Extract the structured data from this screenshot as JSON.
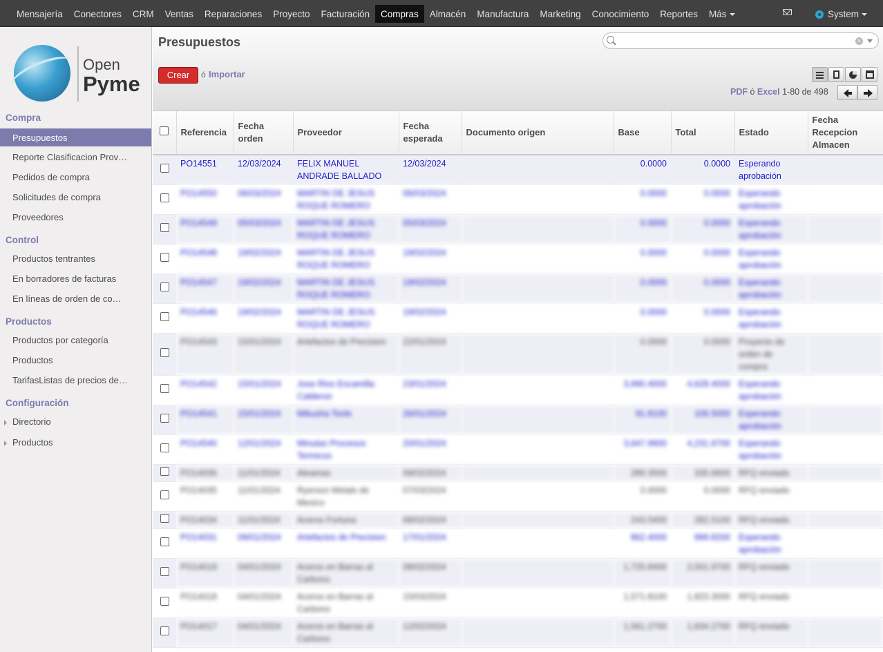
{
  "topbar": {
    "menu": [
      "Mensajería",
      "Conectores",
      "CRM",
      "Ventas",
      "Reparaciones",
      "Proyecto",
      "Facturación",
      "Compras",
      "Almacén",
      "Manufactura",
      "Marketing",
      "Conocimiento",
      "Reportes",
      "Más"
    ],
    "user": "System"
  },
  "logo": {
    "open": "Open",
    "pyme": "Pyme"
  },
  "sidebar": {
    "sections": [
      {
        "title": "Compra",
        "items": [
          "Presupuestos",
          "Reporte Clasificacion Prov…",
          "Pedidos de compra",
          "Solicitudes de compra",
          "Proveedores"
        ]
      },
      {
        "title": "Control",
        "items": [
          "Productos tentrantes",
          "En borradores de facturas",
          "En líneas de orden de co…"
        ]
      },
      {
        "title": "Productos",
        "items": [
          "Productos por categoría",
          "Productos",
          "TarifasListas de precios de…"
        ]
      },
      {
        "title": "Configuración",
        "items": [
          "Directorio",
          "Productos"
        ]
      }
    ]
  },
  "header": {
    "title": "Presupuestos",
    "create": "Crear",
    "or": "ó",
    "import": "Importar",
    "pdf": "PDF",
    "excel": "Excel",
    "pager": "1-80 de 498"
  },
  "table": {
    "columns": [
      "Referencia",
      "Fecha orden",
      "Proveedor",
      "Fecha esperada",
      "Documento origen",
      "Base",
      "Total",
      "Estado",
      "Fecha Recepcion Almacen"
    ],
    "rows": [
      {
        "ref": "PO14551",
        "fecha": "12/03/2024",
        "prov": "FELIX MANUEL ANDRADE BALLADO",
        "esperada": "12/03/2024",
        "doc": "",
        "base": "0.0000",
        "total": "0.0000",
        "estado": "Esperando aprobación",
        "recep": "",
        "blue": true,
        "blur": false
      },
      {
        "ref": "PO14550",
        "fecha": "06/03/2024",
        "prov": "MARTIN DE JESUS ROQUE ROMERO",
        "esperada": "06/03/2024",
        "doc": "",
        "base": "0.0000",
        "total": "0.0000",
        "estado": "Esperando aprobación",
        "recep": "",
        "blue": true,
        "blur": true
      },
      {
        "ref": "PO14549",
        "fecha": "05/03/2024",
        "prov": "MARTIN DE JESUS ROQUE ROMERO",
        "esperada": "05/03/2024",
        "doc": "",
        "base": "0.0000",
        "total": "0.0000",
        "estado": "Esperando aprobación",
        "recep": "",
        "blue": true,
        "blur": true
      },
      {
        "ref": "PO14548",
        "fecha": "19/02/2024",
        "prov": "MARTIN DE JESUS ROQUE ROMERO",
        "esperada": "19/02/2024",
        "doc": "",
        "base": "0.0000",
        "total": "0.0000",
        "estado": "Esperando aprobación",
        "recep": "",
        "blue": true,
        "blur": true
      },
      {
        "ref": "PO14547",
        "fecha": "19/02/2024",
        "prov": "MARTIN DE JESUS ROQUE ROMERO",
        "esperada": "19/02/2024",
        "doc": "",
        "base": "0.0000",
        "total": "0.0000",
        "estado": "Esperando aprobación",
        "recep": "",
        "blue": true,
        "blur": true
      },
      {
        "ref": "PO14546",
        "fecha": "19/02/2024",
        "prov": "MARTIN DE JESUS ROQUE ROMERO",
        "esperada": "19/02/2024",
        "doc": "",
        "base": "0.0000",
        "total": "0.0000",
        "estado": "Esperando aprobación",
        "recep": "",
        "blue": true,
        "blur": true
      },
      {
        "ref": "PO14543",
        "fecha": "15/01/2024",
        "prov": "Artefactos de Precision",
        "esperada": "22/01/2024",
        "doc": "",
        "base": "0.0000",
        "total": "0.0000",
        "estado": "Proyecto de orden de compra",
        "recep": "",
        "blue": false,
        "blur": true
      },
      {
        "ref": "PO14542",
        "fecha": "15/01/2024",
        "prov": "Jose Rios Escamilla Calderon",
        "esperada": "23/01/2024",
        "doc": "",
        "base": "3,990.4000",
        "total": "4,628.4000",
        "estado": "Esperando aprobación",
        "recep": "",
        "blue": true,
        "blur": true
      },
      {
        "ref": "PO14541",
        "fecha": "15/01/2024",
        "prov": "Mikusha Tools",
        "esperada": "26/01/2024",
        "doc": "",
        "base": "91.8100",
        "total": "106.5000",
        "estado": "Esperando aprobación",
        "recep": "",
        "blue": true,
        "blur": true
      },
      {
        "ref": "PO14540",
        "fecha": "12/01/2024",
        "prov": "Minutas Procesos Termicos",
        "esperada": "20/01/2024",
        "doc": "",
        "base": "3,647.9900",
        "total": "4,231.6700",
        "estado": "Esperando aprobación",
        "recep": "",
        "blue": true,
        "blur": true
      },
      {
        "ref": "PO14036",
        "fecha": "11/01/2024",
        "prov": "Aleamas",
        "esperada": "09/02/2024",
        "doc": "",
        "base": "289.3500",
        "total": "335.6600",
        "estado": "RFQ enviado",
        "recep": "",
        "blue": false,
        "blur": true
      },
      {
        "ref": "PO14035",
        "fecha": "11/01/2024",
        "prov": "Ryerson Metals de Mexico",
        "esperada": "07/03/2024",
        "doc": "",
        "base": "0.0000",
        "total": "0.0000",
        "estado": "RFQ enviado",
        "recep": "",
        "blue": false,
        "blur": true
      },
      {
        "ref": "PO14034",
        "fecha": "11/01/2024",
        "prov": "Aceros Fortuna",
        "esperada": "08/02/2024",
        "doc": "",
        "base": "243.5400",
        "total": "282.5100",
        "estado": "RFQ enviado",
        "recep": "",
        "blue": false,
        "blur": true
      },
      {
        "ref": "PO14031",
        "fecha": "09/01/2024",
        "prov": "Artefactos de Precision",
        "esperada": "17/01/2024",
        "doc": "",
        "base": "862.4000",
        "total": "999.8200",
        "estado": "Esperando aprobación",
        "recep": "",
        "blue": true,
        "blur": true
      },
      {
        "ref": "PO14019",
        "fecha": "04/01/2024",
        "prov": "Aceros en Barras al Carbono",
        "esperada": "08/02/2024",
        "doc": "",
        "base": "1,725.8400",
        "total": "2,001.9700",
        "estado": "RFQ enviado",
        "recep": "",
        "blue": false,
        "blur": true
      },
      {
        "ref": "PO14018",
        "fecha": "04/01/2024",
        "prov": "Aceros en Barras al Carbono",
        "esperada": "15/03/2024",
        "doc": "",
        "base": "1,571.8100",
        "total": "1,823.3000",
        "estado": "RFQ enviado",
        "recep": "",
        "blue": false,
        "blur": true
      },
      {
        "ref": "PO14017",
        "fecha": "04/01/2024",
        "prov": "Aceros en Barras al Carbono",
        "esperada": "12/02/2024",
        "doc": "",
        "base": "1,561.2700",
        "total": "1,834.2700",
        "estado": "RFQ enviado",
        "recep": "",
        "blue": false,
        "blur": true
      }
    ]
  }
}
